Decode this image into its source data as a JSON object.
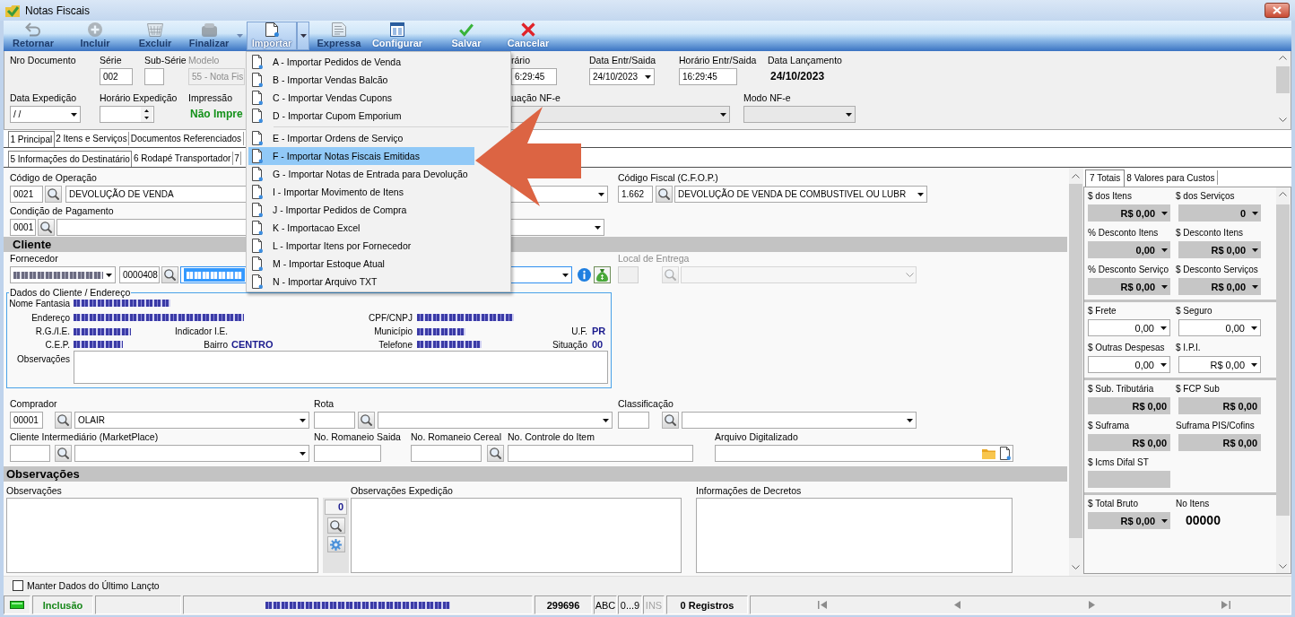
{
  "window": {
    "title": "Notas Fiscais"
  },
  "toolbar": [
    {
      "label": "Retornar",
      "disabled": true,
      "selected": false,
      "dropdown": false
    },
    {
      "label": "Incluir",
      "disabled": true,
      "selected": false,
      "dropdown": false
    },
    {
      "label": "Excluir",
      "disabled": true,
      "selected": false,
      "dropdown": false
    },
    {
      "label": "Finalizar",
      "disabled": true,
      "selected": false,
      "dropdown": true
    },
    {
      "label": "Importar",
      "disabled": false,
      "selected": true,
      "dropdown": true
    },
    {
      "label": "Expressa",
      "disabled": true,
      "selected": false,
      "dropdown": false
    },
    {
      "label": "Configurar",
      "disabled": false,
      "selected": false,
      "dropdown": false
    },
    {
      "label": "Salvar",
      "disabled": false,
      "selected": false,
      "dropdown": false
    },
    {
      "label": "Cancelar",
      "disabled": false,
      "selected": false,
      "dropdown": false
    }
  ],
  "header": {
    "fields": [
      {
        "kind": "label",
        "label": "Nro Documento",
        "disabled": false
      },
      {
        "kind": "text",
        "label": "Série",
        "value": "002",
        "disabled": false
      },
      {
        "kind": "text",
        "label": "Sub-Série",
        "disabled": false
      },
      {
        "kind": "text",
        "label": "Modelo",
        "value": "55 - Nota Fis",
        "disabled": true
      },
      {
        "kind": "text",
        "label": "rário",
        "value": "6:29:45",
        "disabled": false
      },
      {
        "kind": "date",
        "label": "Data Entr/Saida",
        "value": "24/10/2023",
        "disabled": false
      },
      {
        "kind": "text",
        "label": "Horário Entr/Saida",
        "value": "16:29:45",
        "disabled": false
      },
      {
        "kind": "value",
        "label": "Data Lançamento",
        "value": "24/10/2023",
        "disabled": false
      },
      {
        "kind": "combo",
        "label": "Data Expedição",
        "value": "/ /",
        "disabled": false
      },
      {
        "kind": "spin",
        "label": "Horário Expedição",
        "disabled": false
      },
      {
        "kind": "status",
        "label": "Impressão",
        "value": "Não Impre",
        "disabled": false
      },
      {
        "kind": "list",
        "label": "uação NF-e",
        "disabled": false
      },
      {
        "kind": "list",
        "label": "Modo NF-e",
        "disabled": false
      }
    ]
  },
  "tabs": [
    [
      {
        "label": "1 Principal",
        "selected": true
      },
      {
        "label": "2 Itens e Serviços",
        "selected": false
      },
      {
        "label": "Documentos Referenciados",
        "selected": false
      }
    ],
    [
      {
        "label": "5 Informações do Destinatário",
        "selected": true
      },
      {
        "label": "6 Rodapé Transportador",
        "selected": false
      },
      {
        "label": "7",
        "selected": false
      }
    ]
  ],
  "form": [
    {
      "kind": "fields",
      "fields": [
        {
          "kind": "lookup",
          "label": "Código de Operação",
          "code": "0021",
          "value": "DEVOLUÇÃO DE VENDA",
          "disabled": false
        },
        {
          "kind": "lookup",
          "label": "Código Fiscal (C.F.O.P.)",
          "code": "1.662",
          "value": "DEVOLUÇÃO DE VENDA DE COMBUSTIVEL OU LUBR",
          "disabled": false
        }
      ]
    },
    {
      "kind": "fields",
      "fields": [
        {
          "kind": "lookup",
          "label": "Condição de Pagamento",
          "code": "0001",
          "disabled": false
        }
      ]
    },
    {
      "kind": "section",
      "title": "Cliente"
    },
    {
      "kind": "fields",
      "fields": [
        {
          "kind": "supplier",
          "label": "Fornecedor",
          "code": "0000408",
          "disabled": false,
          "blurred": true,
          "selected": true
        },
        {
          "kind": "lookup",
          "label": "Local de Entrega",
          "disabled": true
        }
      ]
    },
    {
      "kind": "group",
      "title": "Dados do Cliente / Endereço",
      "fields": [
        {
          "kind": "text",
          "label": "Nome Fantasia",
          "blurred": true
        },
        {
          "kind": "text",
          "label": "Endereço",
          "blurred": true
        },
        {
          "kind": "text",
          "label": "CPF/CNPJ",
          "blurred": true
        },
        {
          "kind": "text",
          "label": "R.G./I.E.",
          "blurred": true
        },
        {
          "kind": "text",
          "label": "Indicador I.E.",
          "blurred": false
        },
        {
          "kind": "text",
          "label": "Município",
          "blurred": true
        },
        {
          "kind": "text",
          "label": "U.F.",
          "value": "PR",
          "blurred": false
        },
        {
          "kind": "text",
          "label": "C.E.P.",
          "blurred": true
        },
        {
          "kind": "text",
          "label": "Bairro",
          "value": "CENTRO",
          "blurred": false
        },
        {
          "kind": "text",
          "label": "Telefone",
          "blurred": true
        },
        {
          "kind": "text",
          "label": "Situação",
          "value": "00",
          "blurred": false
        },
        {
          "kind": "memo",
          "label": "Observações"
        }
      ]
    },
    {
      "kind": "fields",
      "fields": [
        {
          "kind": "lookup",
          "label": "Comprador",
          "code": "00001",
          "value": "OLAIR",
          "disabled": false
        },
        {
          "kind": "lookup",
          "label": "Rota",
          "disabled": false
        },
        {
          "kind": "lookup",
          "label": "Classificação",
          "disabled": false
        }
      ]
    },
    {
      "kind": "fields",
      "fields": [
        {
          "kind": "lookup",
          "label": "Cliente Intermediário (MarketPlace)",
          "disabled": false
        },
        {
          "kind": "text",
          "label": "No. Romaneio Saida",
          "disabled": false
        },
        {
          "kind": "text_search",
          "label": "No. Romaneio Cereal",
          "disabled": false
        },
        {
          "kind": "text",
          "label": "No. Controle do Item",
          "disabled": false
        },
        {
          "kind": "file",
          "label": "Arquivo Digitalizado",
          "disabled": false
        }
      ]
    },
    {
      "kind": "section",
      "title": "Observações"
    },
    {
      "kind": "memos",
      "memos": [
        {
          "kind": "memo",
          "label": "Observações"
        },
        {
          "kind": "tools",
          "count": "0"
        },
        {
          "kind": "memo",
          "label": "Observações Expedição"
        },
        {
          "kind": "memo",
          "label": "Informações de Decretos"
        }
      ]
    }
  ],
  "import_menu": [
    [
      {
        "label": "A - Importar Pedidos de Venda",
        "selected": false
      },
      {
        "label": "B - Importar Vendas Balcão",
        "selected": false
      },
      {
        "label": "C - Importar Vendas Cupons",
        "selected": false
      },
      {
        "label": "D - Importar Cupom Emporium",
        "selected": false
      }
    ],
    [
      {
        "label": "E - Importar Ordens de Serviço",
        "selected": false
      },
      {
        "label": "F - Importar Notas Fiscais Emitidas",
        "selected": true
      },
      {
        "label": "G - Importar Notas de Entrada para Devolução",
        "selected": false
      },
      {
        "label": "I - Importar Movimento de Itens",
        "selected": false
      },
      {
        "label": "J - Importar Pedidos de Compra",
        "selected": false
      },
      {
        "label": "K - Importacao Excel",
        "selected": false
      },
      {
        "label": "L - Importar Itens por Fornecedor",
        "selected": false
      },
      {
        "label": "M - Importar Estoque Atual",
        "selected": false
      },
      {
        "label": "N - Importar Arquivo TXT",
        "selected": false
      }
    ]
  ],
  "totals": {
    "tabs": [
      {
        "label": "7 Totais",
        "selected": true
      },
      {
        "label": "8 Valores para Custos",
        "selected": false
      }
    ],
    "groups": [
      [
        [
          {
            "label": "$ dos Itens",
            "value": "R$ 0,00",
            "kind": "readonly_dropdown"
          },
          {
            "label": "$ dos Serviços",
            "value": "0",
            "kind": "readonly_dropdown"
          }
        ],
        [
          {
            "label": "% Desconto Itens",
            "value": "0,00",
            "kind": "readonly_dropdown"
          },
          {
            "label": "$ Desconto Itens",
            "value": "R$ 0,00",
            "kind": "readonly_dropdown"
          }
        ],
        [
          {
            "label": "% Desconto Serviço",
            "value": "R$ 0,00",
            "kind": "readonly_dropdown"
          },
          {
            "label": "$ Desconto Serviços",
            "value": "R$ 0,00",
            "kind": "readonly_dropdown"
          }
        ]
      ],
      [
        [
          {
            "label": "$ Frete",
            "value": "0,00",
            "kind": "dropdown"
          },
          {
            "label": "$ Seguro",
            "value": "0,00",
            "kind": "dropdown"
          }
        ],
        [
          {
            "label": "$ Outras Despesas",
            "value": "0,00",
            "kind": "dropdown"
          },
          {
            "label": "$ I.P.I.",
            "value": "R$ 0,00",
            "kind": "dropdown"
          }
        ]
      ],
      [
        [
          {
            "label": "$ Sub. Tributária",
            "value": "R$ 0,00",
            "kind": "readonly"
          },
          {
            "label": "$ FCP Sub",
            "value": "R$ 0,00",
            "kind": "readonly"
          }
        ],
        [
          {
            "label": "$ Suframa",
            "value": "R$ 0,00",
            "kind": "readonly"
          },
          {
            "label": "Suframa PIS/Cofins",
            "value": "R$ 0,00",
            "kind": "readonly"
          }
        ],
        [
          {
            "label": "$ Icms Difal ST",
            "kind": "readonly"
          }
        ]
      ],
      [
        [
          {
            "label": "$ Total Bruto",
            "value": "R$ 0,00",
            "kind": "readonly_dropdown"
          },
          {
            "label": "No Itens",
            "value": "00000",
            "kind": "count"
          }
        ]
      ]
    ]
  },
  "keep_last": {
    "label": "Manter Dados do Último Lançto",
    "checked": false
  },
  "status_bar": {
    "mode": "Inclusão",
    "company_blurred": true,
    "number": "299696",
    "indicators": [
      {
        "label": "ABC",
        "disabled": false
      },
      {
        "label": "0...9",
        "disabled": false
      },
      {
        "label": "INS",
        "disabled": true
      }
    ],
    "records": "0 Registros"
  }
}
